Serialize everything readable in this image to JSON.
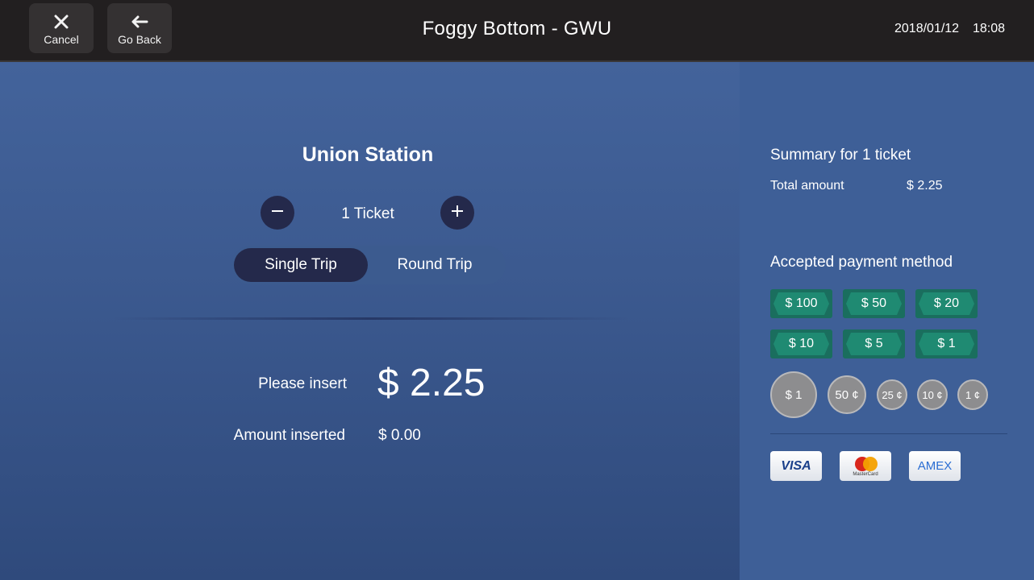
{
  "header": {
    "cancel_label": "Cancel",
    "back_label": "Go Back",
    "title": "Foggy Bottom - GWU",
    "date": "2018/01/12",
    "time": "18:08"
  },
  "trip": {
    "destination": "Union Station",
    "ticket_count": "1 Ticket",
    "options": [
      "Single Trip",
      "Round Trip"
    ],
    "selected": "Single Trip"
  },
  "payment_status": {
    "insert_label": "Please insert",
    "insert_amount": "$ 2.25",
    "inserted_label": "Amount inserted",
    "inserted_amount": "$ 0.00"
  },
  "summary": {
    "title": "Summary for 1 ticket",
    "total_label": "Total amount",
    "total_value": "$ 2.25"
  },
  "payment_methods": {
    "title": "Accepted payment method",
    "bills": [
      "$ 100",
      "$ 50",
      "$ 20",
      "$ 10",
      "$ 5",
      "$ 1"
    ],
    "coins": [
      "$ 1",
      "50 ¢",
      "25 ¢",
      "10 ¢",
      "1 ¢"
    ],
    "cards": [
      "VISA",
      "MasterCard",
      "AMEX"
    ]
  },
  "colors": {
    "topbar": "#221f20",
    "accent_dark": "#24294b",
    "bill_green": "#1f8a72",
    "coin_grey": "#8d8d8f"
  }
}
